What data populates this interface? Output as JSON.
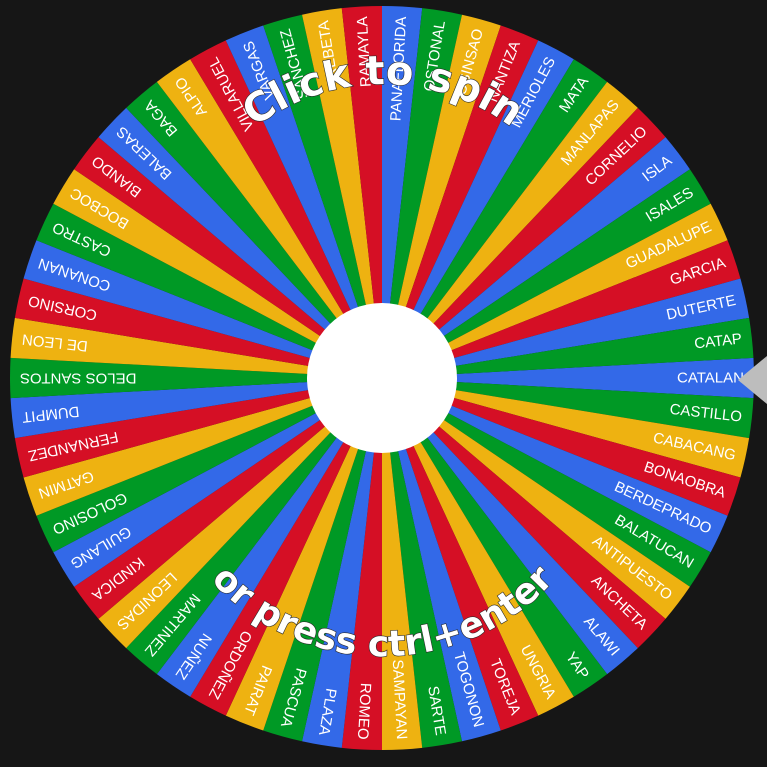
{
  "wheel": {
    "names": [
      "CATALAN",
      "CASTILLO",
      "CABACANG",
      "BONAOBRA",
      "BERDEPRADO",
      "BALATUCAN",
      "ANTIPUESTO",
      "ANCHETA",
      "ALAWI",
      "YAP",
      "UNGRIA",
      "TOREJA",
      "TOGONON",
      "SARTE",
      "SAMPAYAN",
      "ROMEO",
      "PLAZA",
      "PASCUA",
      "PAIRAT",
      "ORDOÑEZ",
      "NUÑEZ",
      "MARTINEZ",
      "LEONIDAS",
      "KINDICA",
      "GUILANG",
      "GOLOSINO",
      "GATMIN",
      "FERNANDEZ",
      "DUMPIT",
      "DELOS SANTOS",
      "DE LEON",
      "CORSINO",
      "CONANAN",
      "CASTRO",
      "BOCBOC",
      "BIANDO",
      "BALERAS",
      "BAGA",
      "ALPIO",
      "VILLARUEL",
      "VARGAS",
      "SANCHEZ",
      "REBETA",
      "RAMAYLA",
      "PANAFLORIDA",
      "OSTONAL",
      "OSINSAO",
      "NANTIZA",
      "MERIOLES",
      "MATA",
      "MANLAPAS",
      "CORNELIO",
      "ISLA",
      "ISALES",
      "GUADALUPE",
      "GARCIA",
      "DUTERTE",
      "CATAP"
    ],
    "colors": [
      "#3369e8",
      "#009925",
      "#eeb211",
      "#d50f25"
    ],
    "top_prompt": "Click to spin",
    "bottom_prompt": "or press ctrl+enter",
    "hub_color": "#ffffff",
    "pointer_color": "#bdbdbd"
  }
}
